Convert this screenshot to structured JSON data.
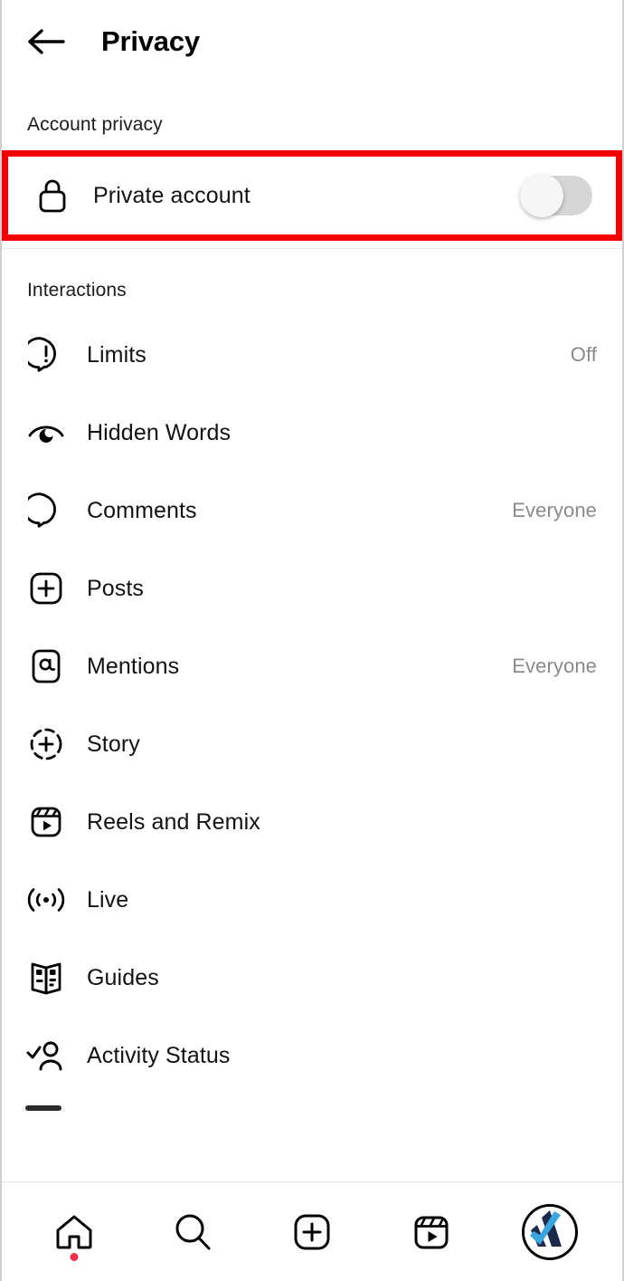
{
  "header": {
    "title": "Privacy",
    "back_icon": "arrow-left-icon"
  },
  "sections": [
    {
      "title": "Account privacy",
      "rows": [
        {
          "label": "Private account",
          "icon": "lock-icon",
          "control": "toggle",
          "toggle_state": "off",
          "highlighted": true
        }
      ]
    },
    {
      "title": "Interactions",
      "rows": [
        {
          "label": "Limits",
          "icon": "speech-bubble-exclamation-icon",
          "value": "Off"
        },
        {
          "label": "Hidden Words",
          "icon": "eye-hidden-icon",
          "value": ""
        },
        {
          "label": "Comments",
          "icon": "comment-bubble-icon",
          "value": "Everyone"
        },
        {
          "label": "Posts",
          "icon": "plus-square-icon",
          "value": ""
        },
        {
          "label": "Mentions",
          "icon": "at-square-icon",
          "value": "Everyone"
        },
        {
          "label": "Story",
          "icon": "story-plus-circle-icon",
          "value": ""
        },
        {
          "label": "Reels and Remix",
          "icon": "reels-icon",
          "value": ""
        },
        {
          "label": "Live",
          "icon": "live-broadcast-icon",
          "value": ""
        },
        {
          "label": "Guides",
          "icon": "guides-book-icon",
          "value": ""
        },
        {
          "label": "Activity Status",
          "icon": "person-check-icon",
          "value": ""
        }
      ]
    }
  ],
  "bottom_nav": [
    {
      "icon": "home-icon",
      "badge": true
    },
    {
      "icon": "search-icon",
      "badge": false
    },
    {
      "icon": "create-plus-icon",
      "badge": false
    },
    {
      "icon": "reels-nav-icon",
      "badge": false
    },
    {
      "icon": "profile-avatar-icon",
      "badge": false
    }
  ],
  "colors": {
    "annotation": "#f40000",
    "badge": "#ef2f4b",
    "value_text": "#8a8a8a",
    "toggle_track_off": "#d6d6d6",
    "avatar_navy": "#1b2a4a",
    "avatar_blue": "#3aa6de"
  }
}
